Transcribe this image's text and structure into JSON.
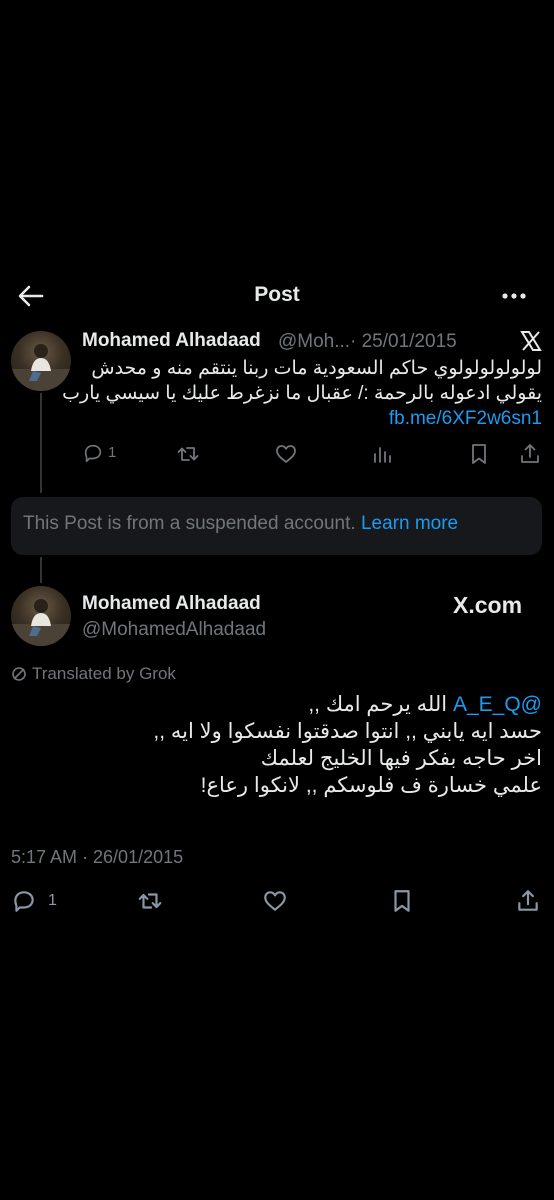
{
  "header": {
    "title": "Post"
  },
  "quoted_post": {
    "author_name": "Mohamed Alhadaad",
    "author_handle": "@Moh...",
    "date": "· 25/01/2015",
    "text_lines": [
      "لولولولولولوي حاكم السعودية مات ربنا ينتقم منه و محدش",
      "يقولي ادعوله بالرحمة :/ عقبال ما نزغرط عليك يا سيسي يارب"
    ],
    "link": "fb.me/6XF2w6sn1",
    "reply_count": "1",
    "icons": [
      "reply-icon",
      "retweet-icon",
      "like-icon",
      "views-icon",
      "bookmark-icon",
      "share-icon"
    ]
  },
  "suspended_notice": {
    "text": "This Post is from a suspended account.",
    "link": "Learn more"
  },
  "main_post": {
    "author_name": "Mohamed Alhadaad",
    "author_handle": "@MohamedAlhadaad",
    "watermark": "X.com",
    "translated_label": "Translated by Grok",
    "mention": "@A_E_Q",
    "first_line_text": "الله يرحم امك ,,",
    "text_lines": [
      "حسد ايه يابني ,, انتوا صدقتوا نفسكوا ولا ايه ,,",
      "اخر حاجه بفكر فيها الخليج لعلمك",
      "علمي خسارة ف فلوسكم ,, لانكوا رعاع!"
    ],
    "timestamp": "5:17 AM · 26/01/2015",
    "reply_count": "1"
  },
  "colors": {
    "background": "#000000",
    "text": "#e7e9ea",
    "muted": "#71767b",
    "link": "#1d9bf0",
    "card": "#16181c"
  }
}
